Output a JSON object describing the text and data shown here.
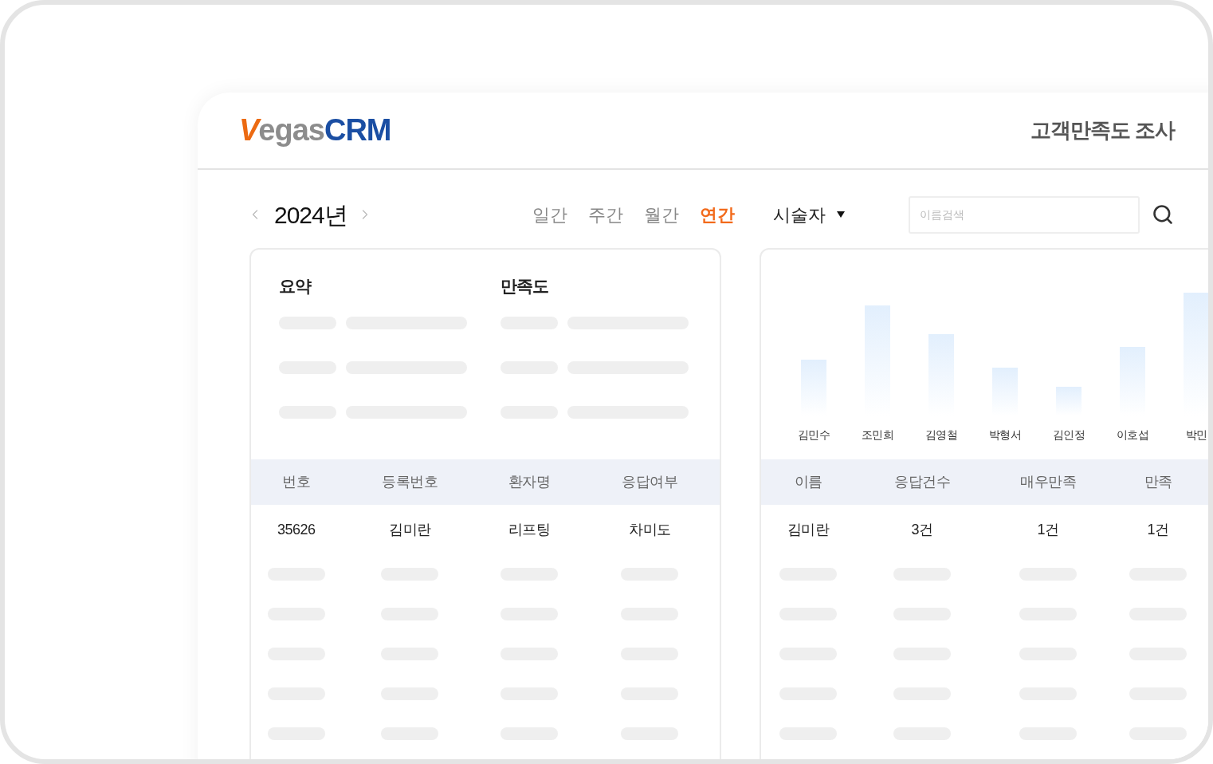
{
  "logo": {
    "accent": "V",
    "middle": "egas",
    "suffix": "CRM"
  },
  "page_title": "고객만족도 조사",
  "year_nav": {
    "label": "2024년"
  },
  "period_tabs": [
    {
      "label": "일간",
      "selected": false
    },
    {
      "label": "주간",
      "selected": false
    },
    {
      "label": "월간",
      "selected": false
    },
    {
      "label": "연간",
      "selected": true
    }
  ],
  "staff_filter": {
    "label": "시술자"
  },
  "search": {
    "placeholder": "이름검색"
  },
  "summary": {
    "headings": [
      "요약",
      "만족도"
    ]
  },
  "left_table": {
    "columns": [
      "번호",
      "등록번호",
      "환자명",
      "응답여부"
    ],
    "rows": [
      [
        "35626",
        "김미란",
        "리프팅",
        "차미도"
      ]
    ]
  },
  "chart": {
    "labels": [
      "김민수",
      "조민희",
      "김영철",
      "박형서",
      "김인정",
      "이호섭",
      "박민"
    ]
  },
  "right_table": {
    "columns": [
      "이름",
      "응답건수",
      "매우만족",
      "만족"
    ],
    "rows": [
      [
        "김미란",
        "3건",
        "1건",
        "1건"
      ]
    ]
  }
}
